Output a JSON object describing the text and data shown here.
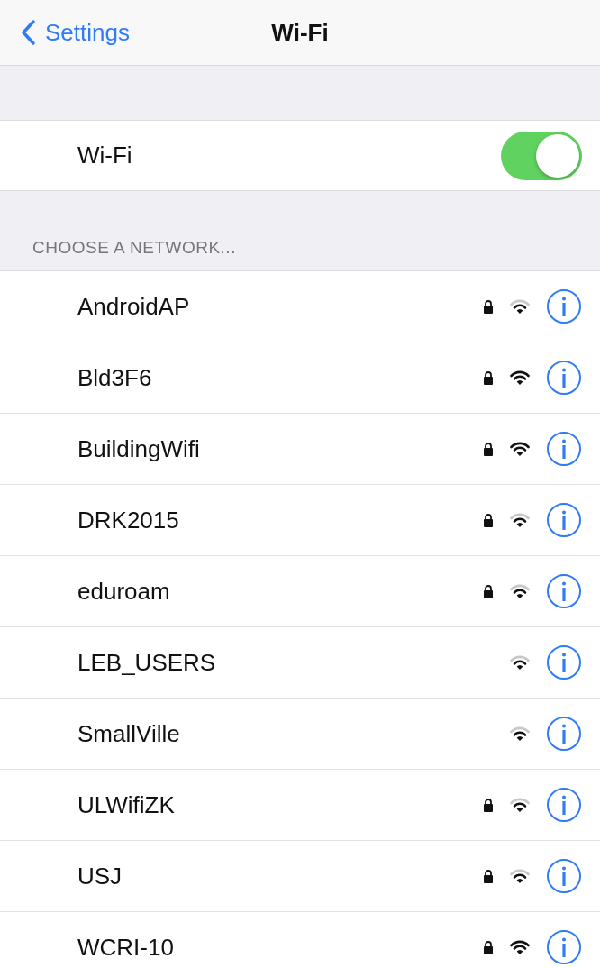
{
  "nav": {
    "back_label": "Settings",
    "title": "Wi-Fi"
  },
  "wifi": {
    "label": "Wi-Fi",
    "on": true
  },
  "section_header": "CHOOSE A NETWORK...",
  "networks": [
    {
      "name": "AndroidAP",
      "locked": true,
      "kind": "medium"
    },
    {
      "name": "Bld3F6",
      "locked": true,
      "kind": "strong"
    },
    {
      "name": "BuildingWifi",
      "locked": true,
      "kind": "strong"
    },
    {
      "name": "DRK2015",
      "locked": true,
      "kind": "medium"
    },
    {
      "name": "eduroam",
      "locked": true,
      "kind": "medium"
    },
    {
      "name": "LEB_USERS",
      "locked": false,
      "kind": "medium"
    },
    {
      "name": "SmallVille",
      "locked": false,
      "kind": "medium"
    },
    {
      "name": "ULWifiZK",
      "locked": true,
      "kind": "medium"
    },
    {
      "name": "USJ",
      "locked": true,
      "kind": "medium"
    },
    {
      "name": "WCRI-10",
      "locked": true,
      "kind": "strong"
    }
  ]
}
